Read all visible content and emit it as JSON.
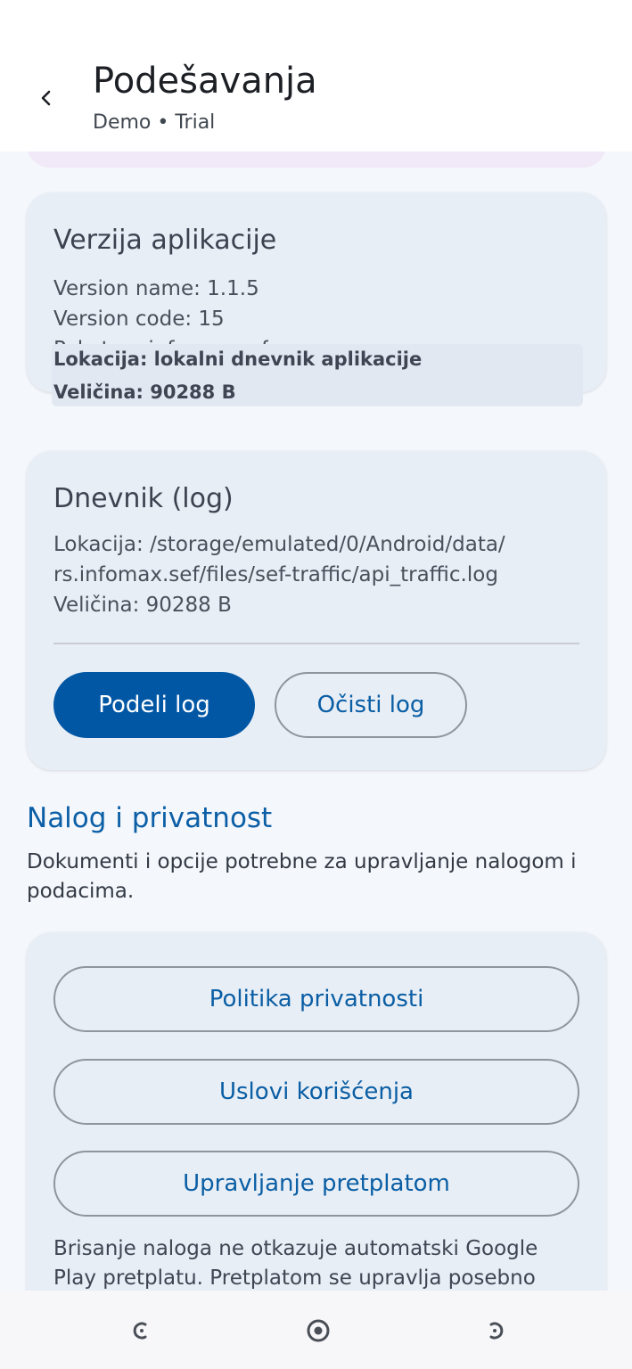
{
  "header": {
    "title": "Podešavanja",
    "subtitle": "Demo • Trial"
  },
  "version_card": {
    "title": "Verzija aplikacije",
    "version_name": "Version name: 1.1.5",
    "version_code": "Version code: 15",
    "cut_line": "Paket: rs.infomax.sef"
  },
  "overlay": {
    "location": "Lokacija: lokalni dnevnik aplikacije",
    "size": "Veličina: 90288 B"
  },
  "log_card": {
    "title": "Dnevnik (log)",
    "location_line1": "Lokacija: /storage/emulated/0/Android/data/",
    "location_line2": "rs.infomax.sef/files/sef-traffic/api_traffic.log",
    "size": "Veličina: 90288 B",
    "share_button": "Podeli log",
    "clear_button": "Očisti log"
  },
  "account_section": {
    "heading": "Nalog i privatnost",
    "description": "Dokumenti i opcije potrebne za upravljanje nalogom i podacima.",
    "privacy_button": "Politika privatnosti",
    "terms_button": "Uslovi korišćenja",
    "subscription_button": "Upravljanje pretplatom",
    "note": "Brisanje naloga ne otkazuje automatski Google Play pretplatu. Pretplatom se upravlja posebno"
  },
  "icons": {
    "back": "chevron-left-icon",
    "nav_back": "nav-back-icon",
    "nav_home": "nav-home-icon",
    "nav_recents": "nav-recents-icon"
  },
  "colors": {
    "primary": "#0257a5",
    "background": "#f4f7fc",
    "card": "#e8eef6",
    "heading_blue": "#0c5fa6"
  }
}
